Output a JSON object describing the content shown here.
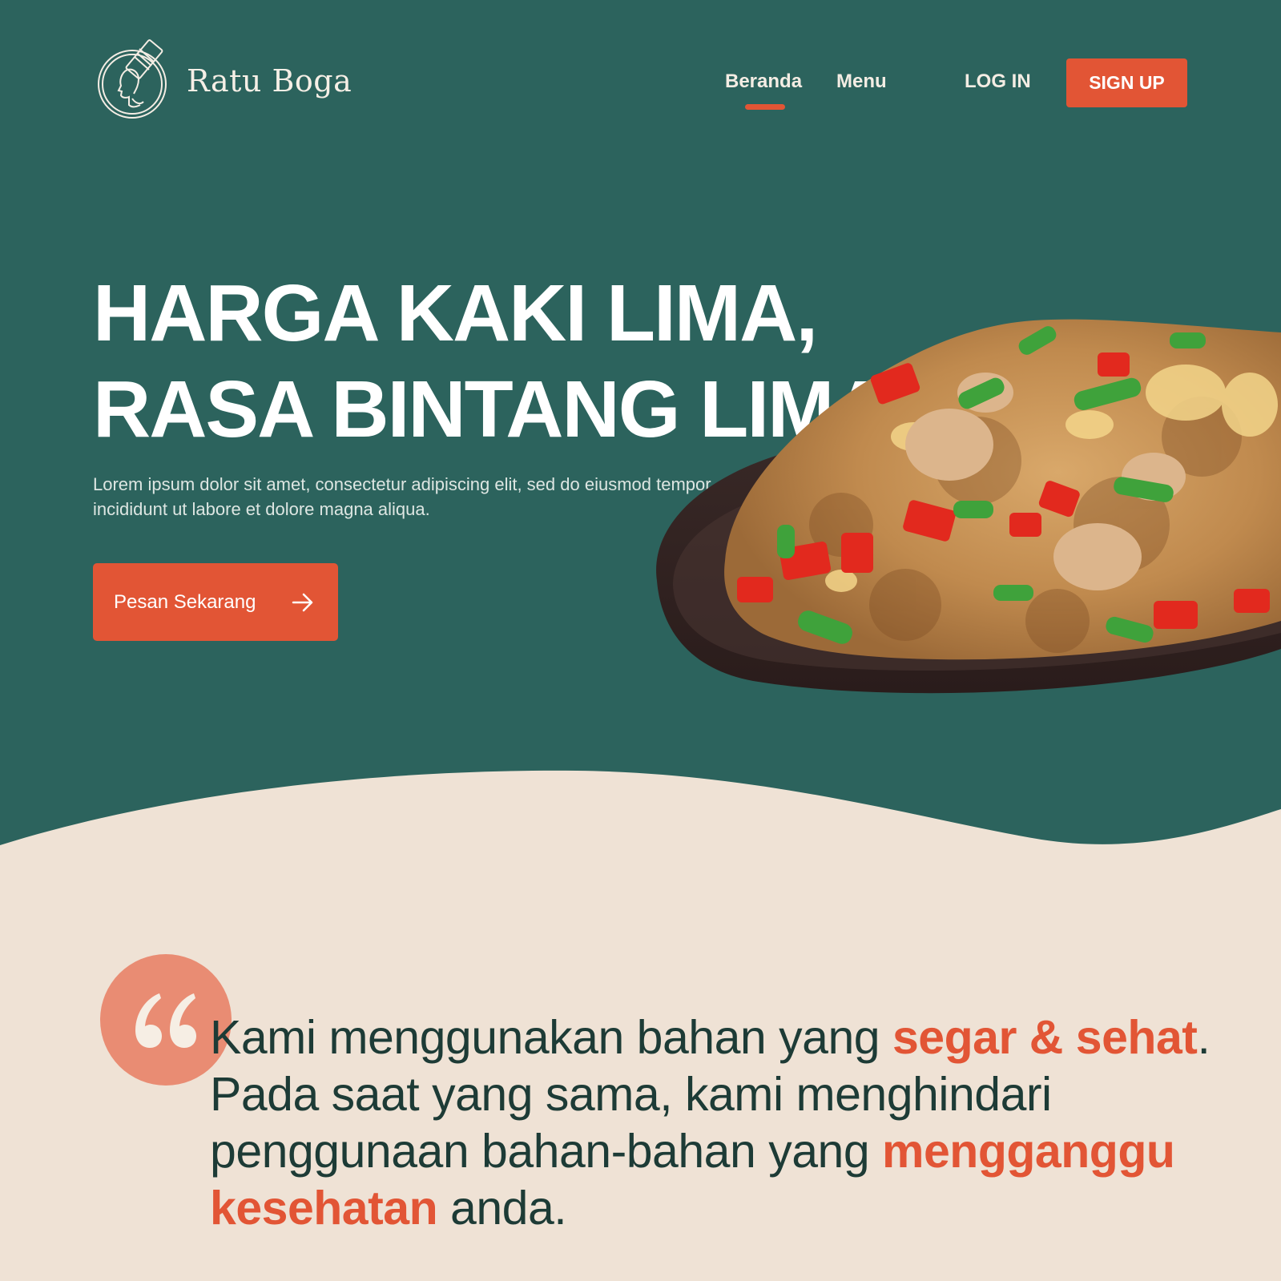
{
  "brand": {
    "name": "Ratu Boga",
    "logo_icon": "woman-chef-icon"
  },
  "nav": {
    "items": [
      {
        "label": "Beranda",
        "active": true
      },
      {
        "label": "Menu",
        "active": false
      }
    ],
    "login_label": "LOG IN",
    "signup_label": "SIGN UP"
  },
  "hero": {
    "headline_line1": "HARGA KAKI LIMA,",
    "headline_line2": "RASA BINTANG LIMA",
    "subtext": "Lorem ipsum dolor sit amet, consectetur adipiscing elit, sed do eiusmod tempor incididunt ut labore et dolore magna aliqua.",
    "cta_label": "Pesan Sekarang",
    "cta_icon": "arrow-right-icon",
    "image": "fried-rice-plate"
  },
  "quote": {
    "icon": "quote-icon",
    "part1": "Kami menggunakan bahan yang ",
    "hl1": "segar & sehat",
    "part2": ". Pada saat yang sama, kami menghindari penggunaan bahan-bahan yang ",
    "hl2": "mengganggu kesehatan",
    "part3": " anda."
  },
  "colors": {
    "hero_bg": "#2C635D",
    "page_bg": "#EFE2D5",
    "accent": "#E25535",
    "quote_bubble": "#E98C73",
    "text_dark": "#1D3B36"
  }
}
